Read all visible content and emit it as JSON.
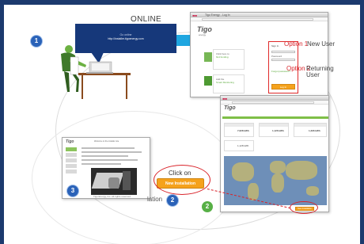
{
  "callout": {
    "title": "ONLINE",
    "line1": "Go online",
    "url": "http://installer.tigoenergy.com"
  },
  "steps": {
    "one": "1",
    "two": "2",
    "three": "3",
    "two_green": "2"
  },
  "login_window": {
    "tab_title": "Tigo Energy - Log In",
    "brand": "Tigo",
    "brand_sub": "energy",
    "option1_label": "Option 1",
    "option1_text": "New User",
    "option2_label": "Option 2",
    "option2_text": "Returning User",
    "card1_title": "Click here to",
    "card1_sub": "find funding",
    "card2_title": "Add the",
    "card2_sub": "Smart Monitoring",
    "login_head": "Sign In",
    "email_label": "Email",
    "password_label": "Password",
    "forgot": "Forgot password?",
    "login_btn": "Log In"
  },
  "dashboard_window": {
    "brand": "Tigo",
    "stats": [
      "7,628 kWh",
      "1,126 kWh",
      "1,296 kWh",
      "1,128 kWh"
    ],
    "btn": "New Installation"
  },
  "installer_window": {
    "brand": "Tigo",
    "heading": "Welcome to the installer site",
    "footer": "Tigo Energy, Inc. All rights reserved"
  },
  "cta": {
    "click_on": "Click on",
    "button": "New Installation",
    "partial_text": "lation"
  },
  "colors": {
    "navy": "#16387a",
    "cyan": "#1fa6e0",
    "red": "#d9242b",
    "orange": "#f5a21c",
    "green": "#57b046"
  }
}
